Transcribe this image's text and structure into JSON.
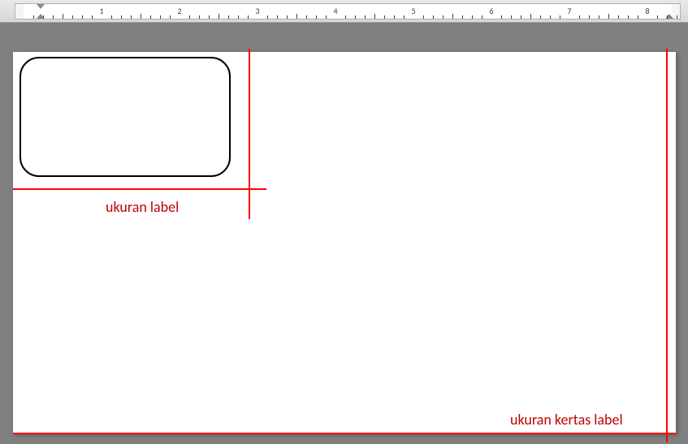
{
  "ruler": {
    "numbers": [
      "1",
      "2",
      "3",
      "4",
      "5",
      "6",
      "7",
      "8"
    ]
  },
  "annotations": {
    "label_size": "ukuran label",
    "paper_size": "ukuran kertas label"
  },
  "colors": {
    "annotation_red": "#c00000",
    "line_red": "#ff0000"
  }
}
